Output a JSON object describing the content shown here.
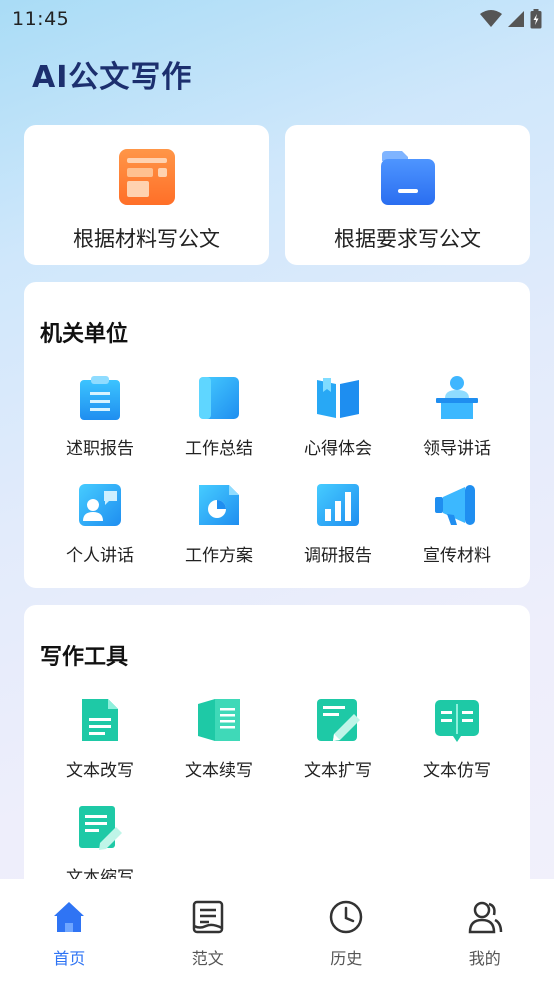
{
  "status_bar": {
    "time": "11:45"
  },
  "app_title": "AI公文写作",
  "quick_actions": [
    {
      "label": "根据材料写公文",
      "icon": "orange-document-icon",
      "color": "#ff7a33"
    },
    {
      "label": "根据要求写公文",
      "icon": "blue-folder-icon",
      "color": "#2f74f4"
    }
  ],
  "agency_section": {
    "title": "机关单位",
    "items": [
      {
        "label": "述职报告",
        "icon": "clipboard-icon"
      },
      {
        "label": "工作总结",
        "icon": "notebook-icon"
      },
      {
        "label": "心得体会",
        "icon": "open-book-icon"
      },
      {
        "label": "领导讲话",
        "icon": "podium-speaker-icon"
      },
      {
        "label": "个人讲话",
        "icon": "person-speech-icon"
      },
      {
        "label": "工作方案",
        "icon": "pie-chart-doc-icon"
      },
      {
        "label": "调研报告",
        "icon": "bar-chart-icon"
      },
      {
        "label": "宣传材料",
        "icon": "megaphone-icon"
      }
    ]
  },
  "tools_section": {
    "title": "写作工具",
    "items": [
      {
        "label": "文本改写",
        "icon": "document-lines-icon"
      },
      {
        "label": "文本续写",
        "icon": "open-notebook-icon"
      },
      {
        "label": "文本扩写",
        "icon": "edit-pencil-icon"
      },
      {
        "label": "文本仿写",
        "icon": "open-book-lines-icon"
      },
      {
        "label": "文本缩写",
        "icon": "document-pen-icon"
      }
    ]
  },
  "bottom_nav": [
    {
      "label": "首页",
      "icon": "home-icon",
      "active": true
    },
    {
      "label": "范文",
      "icon": "article-icon",
      "active": false
    },
    {
      "label": "历史",
      "icon": "clock-icon",
      "active": false
    },
    {
      "label": "我的",
      "icon": "users-icon",
      "active": false
    }
  ],
  "colors": {
    "accent": "#2f74f4",
    "tool_teal": "#1fc7a8",
    "agency_blue": "#1ea3f0"
  }
}
